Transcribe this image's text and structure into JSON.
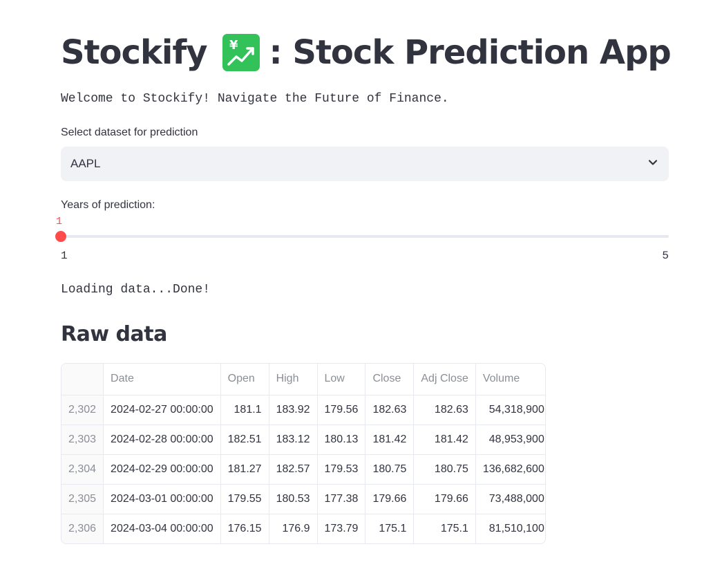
{
  "header": {
    "title_prefix": "Stockify",
    "title_suffix": ": Stock Prediction App",
    "emoji_icon": "chart-increasing-with-yen-icon",
    "welcome": "Welcome to Stockify! Navigate the Future of Finance."
  },
  "dataset_select": {
    "label": "Select dataset for prediction",
    "value": "AAPL"
  },
  "years_slider": {
    "label": "Years of prediction:",
    "value": "1",
    "min": "1",
    "max": "5"
  },
  "status": {
    "loading": "Loading data...Done!"
  },
  "raw_data": {
    "heading": "Raw data",
    "columns": [
      "",
      "Date",
      "Open",
      "High",
      "Low",
      "Close",
      "Adj Close",
      "Volume"
    ],
    "rows": [
      [
        "2,302",
        "2024-02-27 00:00:00",
        "181.1",
        "183.92",
        "179.56",
        "182.63",
        "182.63",
        "54,318,900"
      ],
      [
        "2,303",
        "2024-02-28 00:00:00",
        "182.51",
        "183.12",
        "180.13",
        "181.42",
        "181.42",
        "48,953,900"
      ],
      [
        "2,304",
        "2024-02-29 00:00:00",
        "181.27",
        "182.57",
        "179.53",
        "180.75",
        "180.75",
        "136,682,600"
      ],
      [
        "2,305",
        "2024-03-01 00:00:00",
        "179.55",
        "180.53",
        "177.38",
        "179.66",
        "179.66",
        "73,488,000"
      ],
      [
        "2,306",
        "2024-03-04 00:00:00",
        "176.15",
        "176.9",
        "173.79",
        "175.1",
        "175.1",
        "81,510,100"
      ]
    ]
  },
  "colors": {
    "accent": "#ff4b4b",
    "text": "#31333f",
    "muted": "#8b8e97",
    "input_bg": "#f0f2f6",
    "emoji_bg": "#33c15a"
  }
}
